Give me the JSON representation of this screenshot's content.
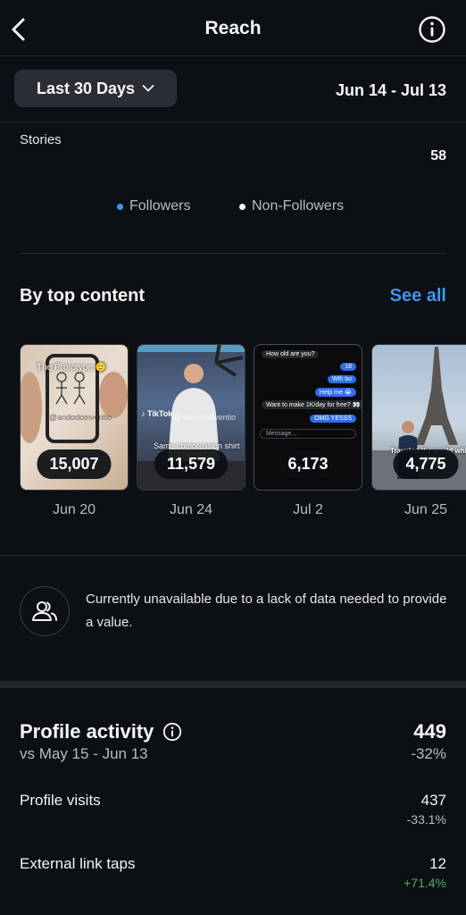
{
  "header": {
    "title": "Reach",
    "back_icon": "chevron-left-icon",
    "info_icon": "info-icon"
  },
  "filter": {
    "range_label": "Last 30 Days",
    "date_range": "Jun 14 - Jul 13"
  },
  "stories": {
    "label": "Stories",
    "value": "58"
  },
  "legend": [
    {
      "label": "Followers",
      "color": "#3d95f0"
    },
    {
      "label": "Non-Followers",
      "color": "#f5f5f5"
    }
  ],
  "top_content": {
    "title": "By top content",
    "see_all": "See all",
    "items": [
      {
        "value": "15,007",
        "date": "Jun 20",
        "caption": "The Prototype 🙂",
        "watermark": "@andodoinventio"
      },
      {
        "value": "11,579",
        "date": "Jun 24",
        "caption": "Same compression shirt",
        "watermark": "@andodoinventio"
      },
      {
        "value": "6,173",
        "date": "Jul 2",
        "chat": [
          "How old are you?",
          "18",
          "Wth bo",
          "Help me 😭",
          "Want to make 1K/day for free? 👀",
          "OMG YESSS",
          "Message..."
        ]
      },
      {
        "value": "4,775",
        "date": "Jun 25",
        "caption": "Traveled the world while my"
      }
    ]
  },
  "notice": {
    "text": "Currently unavailable due to a lack of data needed to provide a value."
  },
  "profile_activity": {
    "title": "Profile activity",
    "comparison": "vs May 15 - Jun 13",
    "value": "449",
    "change": "-32%",
    "rows": [
      {
        "label": "Profile visits",
        "value": "437",
        "change": "-33.1%",
        "change_color": "#b7bcc4"
      },
      {
        "label": "External link taps",
        "value": "12",
        "change": "+71.4%",
        "change_color": "#3fb35f"
      }
    ]
  }
}
